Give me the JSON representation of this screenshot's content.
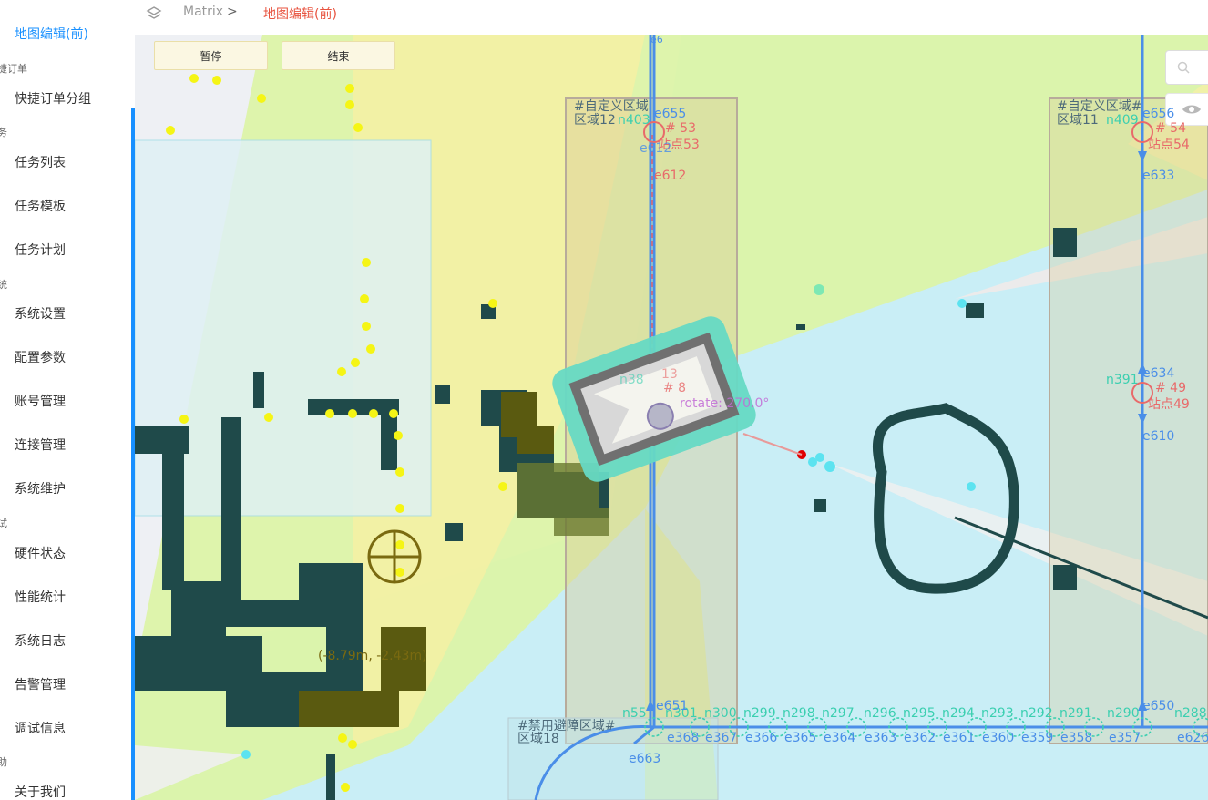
{
  "sidebar": {
    "items": [
      {
        "label": "地图编辑(前)",
        "active": true
      },
      {
        "group": "捷订单"
      },
      {
        "label": "快捷订单分组"
      },
      {
        "group": "务"
      },
      {
        "label": "任务列表"
      },
      {
        "label": "任务模板"
      },
      {
        "label": "任务计划"
      },
      {
        "group": "统"
      },
      {
        "label": "系统设置"
      },
      {
        "label": "配置参数"
      },
      {
        "label": "账号管理"
      },
      {
        "label": "连接管理"
      },
      {
        "label": "系统维护"
      },
      {
        "group": "试"
      },
      {
        "label": "硬件状态"
      },
      {
        "label": "性能统计"
      },
      {
        "label": "系统日志"
      },
      {
        "label": "告警管理"
      },
      {
        "label": "调试信息"
      },
      {
        "group": "助"
      },
      {
        "label": "关于我们"
      }
    ]
  },
  "header": {
    "breadcrumb_root": "Matrix",
    "separator": ">",
    "breadcrumb_current": "地图编辑(前)",
    "current_color": "#e8533f"
  },
  "controls": {
    "pause": "暂停",
    "stop": "结束",
    "search_icon": "search-icon",
    "eye_icon": "eye-icon"
  },
  "map": {
    "areas": [
      {
        "title": "#自定义区域",
        "name": "区域12"
      },
      {
        "title": "#自定义区域#",
        "name": "区域11"
      },
      {
        "title": "#禁用避障区域#",
        "name": "区域18"
      }
    ],
    "stations": [
      {
        "id": "# 53",
        "name": "站点53"
      },
      {
        "id": "# 54",
        "name": "站点54"
      },
      {
        "id": "# 49",
        "name": "站点49"
      },
      {
        "id": "# 8",
        "name": "13"
      }
    ],
    "robot": {
      "rotate": "rotate: 270.0°",
      "position": "(-8.79m, -2.43m)"
    },
    "nodes": {
      "n403": "n403",
      "n409": "n409",
      "n391": "n391",
      "n38": "n38",
      "n55": "n55",
      "n301": "n301",
      "n300": "n300",
      "n299": "n299",
      "n298": "n298",
      "n297": "n297",
      "n296": "n296",
      "n295": "n295",
      "n294": "n294",
      "n293": "n293",
      "n292": "n292",
      "n291": "n291",
      "n290": "n290",
      "n288": "n288"
    },
    "edges": {
      "e655": "e655",
      "e612a": "e612",
      "e612": "e612",
      "e656": "e656",
      "e633": "e633",
      "e634": "e634",
      "e610": "e610",
      "e651": "e651",
      "e650": "e650",
      "e663": "e663",
      "e368": "e368",
      "e367": "e367",
      "e366": "e366",
      "e365": "e365",
      "e364": "e364",
      "e363": "e363",
      "e362": "e362",
      "e361": "e361",
      "e360": "e360",
      "e359": "e359",
      "e358": "e358",
      "e357": "e357",
      "e626": "e626",
      "e6": "e6"
    },
    "colors": {
      "path": "#4a8ee8",
      "node": "#3bcfb0",
      "station": "#e86a6a",
      "laser_cone": "#e4f2b0",
      "obstacle": "#1f4a4a",
      "robot": "#66d9c4"
    }
  }
}
